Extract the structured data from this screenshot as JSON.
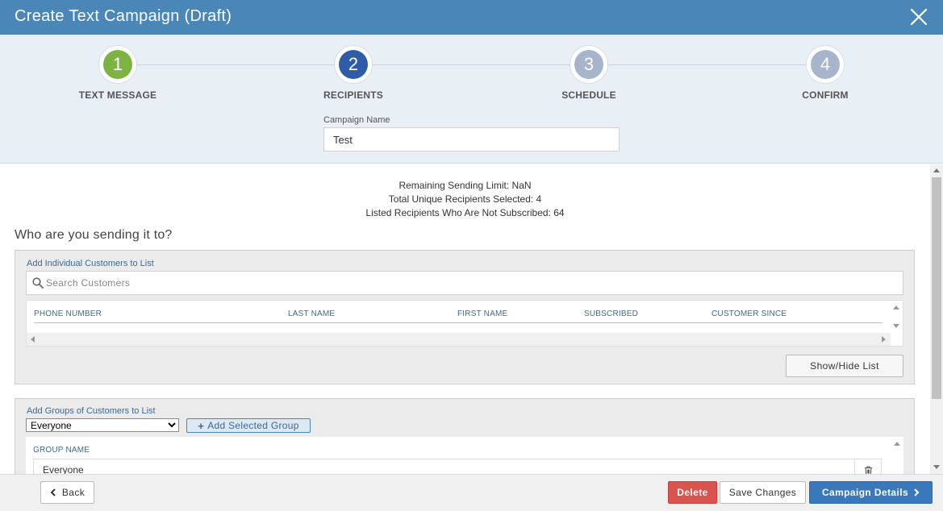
{
  "window": {
    "title": "Create Text Campaign (Draft)"
  },
  "steps": [
    {
      "number": "1",
      "label": "TEXT MESSAGE",
      "color": "#7cb342"
    },
    {
      "number": "2",
      "label": "RECIPIENTS",
      "color": "#2e5ca8"
    },
    {
      "number": "3",
      "label": "SCHEDULE",
      "color": "#a6b4cc"
    },
    {
      "number": "4",
      "label": "CONFIRM",
      "color": "#a6b4cc"
    }
  ],
  "campaign": {
    "label": "Campaign Name",
    "value": "Test"
  },
  "info": {
    "line1": "Remaining Sending Limit: NaN",
    "line2": "Total Unique Recipients Selected: 4",
    "line3": "Listed Recipients Who Are Not Subscribed: 64"
  },
  "question": "Who are you sending it to?",
  "individual": {
    "label": "Add Individual Customers to List",
    "search_placeholder": "Search Customers",
    "columns": [
      "PHONE NUMBER",
      "LAST NAME",
      "FIRST NAME",
      "SUBSCRIBED",
      "CUSTOMER SINCE"
    ],
    "show_hide_label": "Show/Hide List"
  },
  "groups": {
    "label": "Add Groups of Customers to List",
    "selected": "Everyone",
    "add_label": "Add Selected Group",
    "column": "GROUP NAME",
    "rows": [
      "Everyone"
    ]
  },
  "footer": {
    "back_label": "Back",
    "delete_label": "Delete",
    "save_label": "Save Changes",
    "details_label": "Campaign Details"
  }
}
